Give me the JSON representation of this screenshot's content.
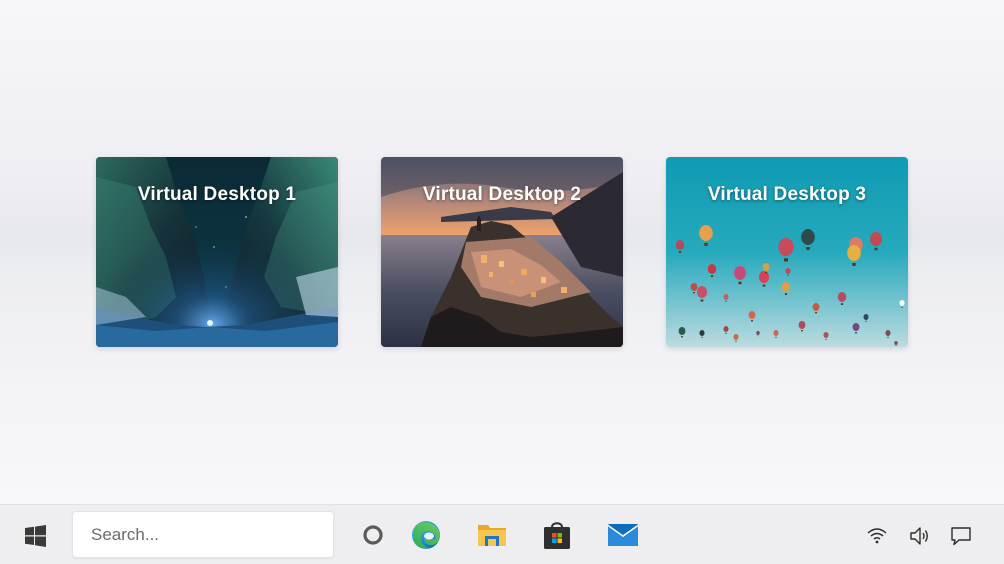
{
  "desktops": [
    {
      "title": "Virtual Desktop 1",
      "wallpaper": "night-canyon-stars"
    },
    {
      "title": "Virtual Desktop 2",
      "wallpaper": "coastal-village-sunset"
    },
    {
      "title": "Virtual Desktop 3",
      "wallpaper": "hot-air-balloons-sky"
    }
  ],
  "taskbar": {
    "search": {
      "placeholder": "Search...",
      "value": ""
    },
    "icons": [
      "windows-start-icon",
      "cortana-icon",
      "edge-icon",
      "file-explorer-icon",
      "store-icon",
      "mail-icon"
    ],
    "tray": [
      "wifi-icon",
      "volume-icon",
      "notifications-icon"
    ]
  },
  "colors": {
    "taskbar_bg": "#eeeef1",
    "accent": "#0078d4",
    "desktop_bg": "#f3f3f6"
  }
}
